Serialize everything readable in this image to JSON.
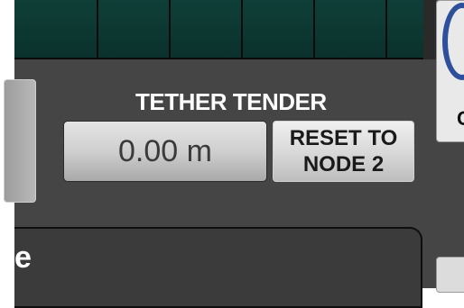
{
  "top_strip": {
    "segment_count": 6,
    "color": "#0c3832"
  },
  "tether_tender": {
    "title": "TETHER TENDER",
    "value": "0.00 m",
    "reset_label_line1": "RESET TO",
    "reset_label_line2": "NODE 2"
  },
  "right_tile": {
    "visible_letter": "C",
    "logo_color": "#2e4f9c"
  },
  "lower_panel": {
    "visible_glyph": "e"
  },
  "colors": {
    "panel_background": "#454545",
    "title_text": "#ffffff",
    "button_text": "#1a1a1a"
  }
}
